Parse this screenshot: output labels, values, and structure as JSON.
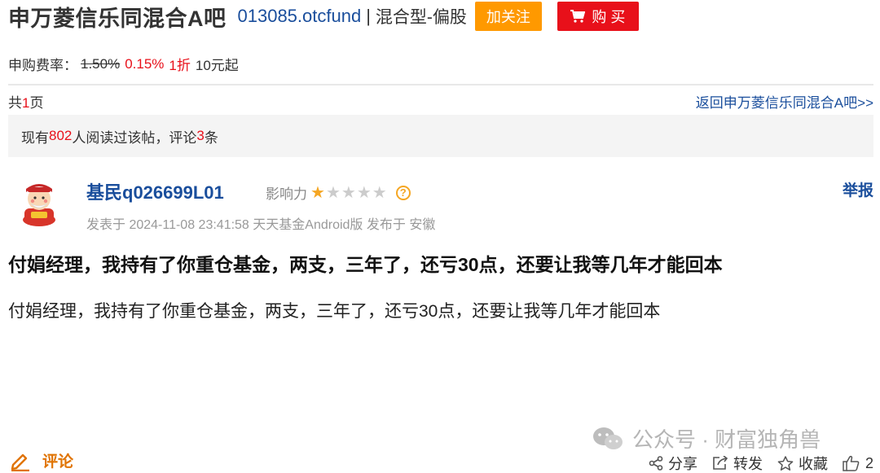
{
  "header": {
    "bar_title": "申万菱信乐同混合A吧",
    "fund_code": "013085.otcfund",
    "separator": "|",
    "fund_type": "混合型-偏股",
    "follow_label": "加关注",
    "buy_label": "购 买"
  },
  "fee": {
    "label": "申购费率：",
    "original_rate": "1.50%",
    "current_rate": "0.15%",
    "discount": "1折",
    "minimum": "10元起"
  },
  "pager": {
    "prefix": "共",
    "count": "1",
    "suffix": "页",
    "back_link": "返回申万菱信乐同混合A吧>>"
  },
  "stats": {
    "prefix": "现有",
    "readers": "802",
    "middle": "人阅读过该帖，评论",
    "comments": "3",
    "suffix": "条"
  },
  "post": {
    "username": "基民q026699L01",
    "influence_label": "影响力",
    "influence_stars": 1,
    "influence_max": 5,
    "report_label": "举报",
    "meta": "发表于 2024-11-08 23:41:58 天天基金Android版 发布于 安徽",
    "title": "付娟经理，我持有了你重仓基金，两支，三年了，还亏30点，还要让我等几年才能回本",
    "body": "付娟经理，我持有了你重仓基金，两支，三年了，还亏30点，还要让我等几年才能回本"
  },
  "footer": {
    "comment_label": "评论",
    "watermark": "公众号 · 财富独角兽",
    "share_label": "分享",
    "forward_label": "转发",
    "favorite_label": "收藏",
    "like_count": "2"
  },
  "colors": {
    "accent_blue": "#1a4e9c",
    "highlight_red": "#e8101a",
    "follow_orange": "#ff9900",
    "star_gold": "#f5a623"
  }
}
